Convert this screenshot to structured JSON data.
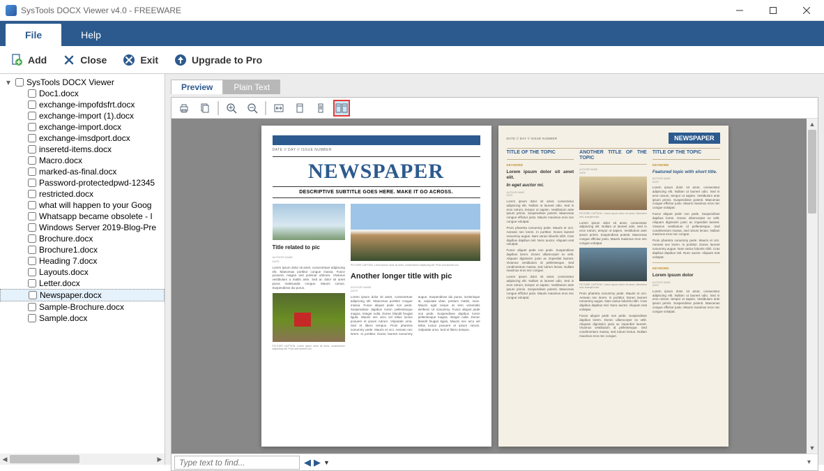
{
  "window": {
    "title": "SysTools DOCX Viewer v4.0 - FREEWARE"
  },
  "menu": {
    "file": "File",
    "help": "Help"
  },
  "toolbar": {
    "add": "Add",
    "close": "Close",
    "exit": "Exit",
    "upgrade": "Upgrade to Pro"
  },
  "tree": {
    "root": "SysTools DOCX Viewer",
    "items": [
      "Doc1.docx",
      "exchange-impofdsfrt.docx",
      "exchange-import (1).docx",
      "exchange-import.docx",
      "exchange-imsdport.docx",
      "inseretd-items.docx",
      "Macro.docx",
      "marked-as-final.docx",
      "Password-protectedpwd-12345",
      "restricted.docx",
      "what will happen to your Goog",
      "Whatsapp became obsolete - I",
      "Windows Server 2019-Blog-Pre",
      "Brochure.docx",
      "Brochure1.docx",
      "Heading 7.docx",
      "Layouts.docx",
      "Letter.docx",
      "Newspaper.docx",
      "Sample-Brochure.docx",
      "Sample.docx"
    ],
    "selected_index": 18
  },
  "viewtabs": {
    "preview": "Preview",
    "plaintext": "Plain Text"
  },
  "find": {
    "placeholder": "Type text to find..."
  },
  "doc": {
    "page1": {
      "dateline": "DATE  //  DAY  //  ISSUE NUMBER",
      "title": "NEWSPAPER",
      "subtitle": "DESCRIPTIVE SUBTITLE GOES HERE. MAKE IT GO ACROSS.",
      "col1_heading": "Title related to pic",
      "col2_heading": "Another longer title with pic",
      "author": "AUTHOR NAME",
      "date": "DATE",
      "caption": "PICTURE CAPTION. Lorem ipsum dolor sit amet, consectetuer adipiscing elit. Proin sed laoreet orci.",
      "body": "Lorem ipsum dolor sit amet, consectetuer adipiscing elit. Maecenas porttitor congue massa. Fusce posuere, magna sed pulvinar ultricies. Vivamus vestibulum a mattis ante. Sed ac dolor sit amet purus malesuada congue. Mauris cursus. Suspendisse dui purus.",
      "body2": "Lorem ipsum dolor sit amet, consectetuer adipiscing elit. Maecenas porttitor congue massa.",
      "body3": "Fusce aliquet pede non pede. Suspendisse dapibus lorem pellentesque magna. Integer nulla. Donec blandit feugiat ligula. Mauris nec arcu vel tellus luctus posuere et ipsum rutrum. Vulputate urna. Sed et libero tempus.",
      "body4": "Proin pharetra nonummy pede. Mauris et orci. Aenean nec lorem. In porttitor. Donec laoreet nonummy augue. Suspendisse dui purus, scelerisque at, vulputate vitae, pretium mattis, nunc. Mauris eget neque at sem venenatis eleifend. Ut nonummy."
    },
    "page2": {
      "dateline": "DATE  //  DAY  //  ISSUE NUMBER",
      "badge": "NEWSPAPER",
      "col1_title": "TITLE OF THE TOPIC",
      "col2_title": "ANOTHER TITLE OF THE TOPIC",
      "col3_title": "TITLE OF THE TOPIC",
      "keyword": "KEYWORD",
      "col1_lead": "Lorem ipsum dolor sit amet elit.",
      "col1_lead2": "In eget auctor mi.",
      "col3_lead": "Featured topic with short title.",
      "author": "AUTHOR NAME",
      "date": "DATE",
      "body": "Lorem ipsum dolor sit amet, consectetur adipiscing elit. Nullam ut laoreet odio. Sed in eros rutrum, tempor ut sapien. Vestibulum ante ipsum primis. Suspendisse potenti. Maecenas congue efficitur justo. Mauris maximus eros nec congue volutpat.",
      "body2": "Proin pharetra nonummy pede. Mauris et orci. Aenean nec lorem. In porttitor. Donec laoreet nonummy augue. Nam varius lobortis nibh. Cras dapibus dapibus nisl. Nunc auctor. Aliquam erat volutpat.",
      "body3": "Fusce aliquet pede non pede. Suspendisse dapibus lorem. Donec ullamcorper ex velit. Aliquam dignissim justo ac imperdiet laoreet. Vivamus vestibulum id pellentesque. Sed condimentum massa, sed rutrum lectus. Nullam maximus eros nec congue.",
      "caption": "PICTURE CAPTION. Lorem ipsum dolor sit amet, bibendum sed, suscipit nulla.",
      "lorem_title": "Lorem ipsum dolor"
    }
  }
}
